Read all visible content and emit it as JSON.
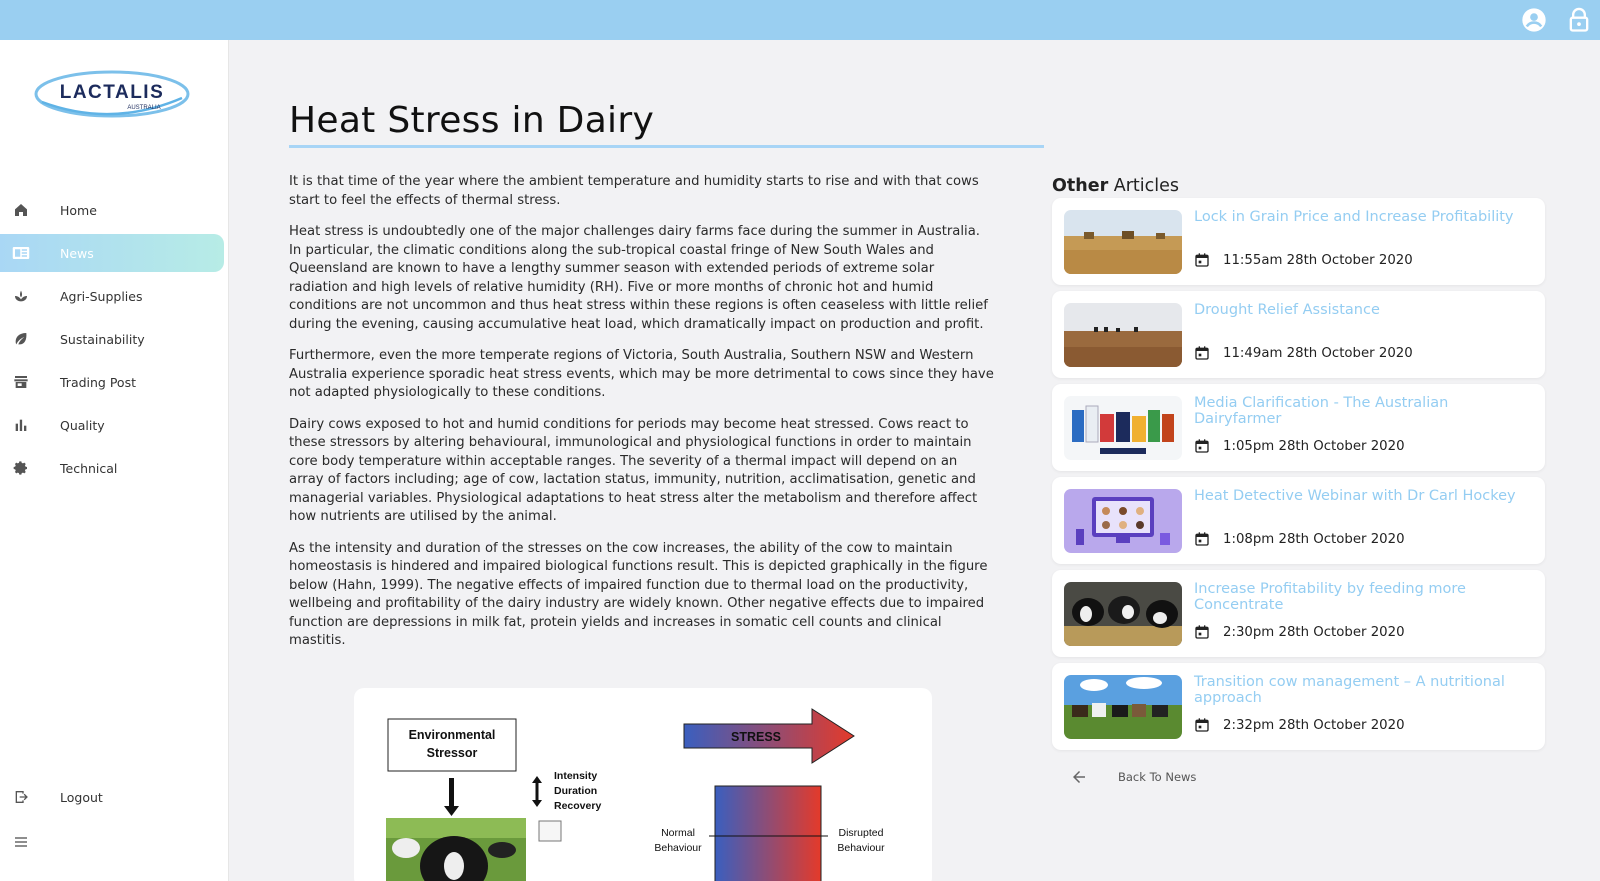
{
  "brand": {
    "name": "LACTALIS",
    "sub": "AUSTRALIA",
    "color": "#1c2b5c",
    "accent": "#9acff1"
  },
  "topbar": {
    "icons": [
      "account-circle-icon",
      "lock-icon"
    ]
  },
  "sidebar": {
    "items": [
      {
        "label": "Home",
        "icon": "home-icon",
        "active": false
      },
      {
        "label": "News",
        "icon": "news-icon",
        "active": true
      },
      {
        "label": "Agri-Supplies",
        "icon": "plant-icon",
        "active": false
      },
      {
        "label": "Sustainability",
        "icon": "leaf-icon",
        "active": false
      },
      {
        "label": "Trading Post",
        "icon": "store-icon",
        "active": false
      },
      {
        "label": "Quality",
        "icon": "bar-chart-icon",
        "active": false
      },
      {
        "label": "Technical",
        "icon": "gear-icon",
        "active": false
      }
    ],
    "logout": "Logout",
    "menu_icon": "hamburger-icon"
  },
  "article": {
    "title": "Heat Stress in Dairy",
    "paragraphs": [
      "It is that time of the year where the ambient temperature and humidity starts to rise and with that cows start to feel the effects of thermal stress.",
      "Heat stress is undoubtedly one of the major challenges dairy farms face during the summer in Australia. In particular, the climatic conditions along the sub-tropical coastal fringe of New South Wales and Queensland are known to have a lengthy summer season with extended periods of extreme solar radiation and high levels of relative humidity (RH). Five or more months of chronic hot and humid conditions are not uncommon and thus heat stress within these regions is often ceaseless with little relief during the evening, causing accumulative heat load, which dramatically impact on production and profit.",
      "Furthermore, even the more temperate regions of Victoria, South Australia, Southern NSW and Western Australia experience sporadic heat stress events, which may be more detrimental to cows since they have not adapted physiologically to these conditions.",
      "Dairy cows exposed to hot and humid conditions for periods may become heat stressed. Cows react to these stressors by altering behavioural, immunological and physiological functions in order to maintain core body temperature within acceptable ranges. The severity of a thermal impact will depend on an array of factors including; age of cow, lactation status, immunity, nutrition, acclimatisation, genetic and managerial variables. Physiological adaptations to heat stress alter the metabolism and therefore affect how nutrients are utilised by the animal.",
      "As the intensity and duration of the stresses on the cow increases, the ability of the cow to maintain homeostasis is hindered and impaired biological functions result. This is depicted graphically in the figure below (Hahn, 1999). The negative effects of impaired function due to thermal load on the productivity, wellbeing and profitability of the dairy industry are widely known. Other negative effects due to impaired function are depressions in milk fat, protein yields and increases in somatic cell counts and clinical mastitis."
    ],
    "figure": {
      "box_line1": "Environmental",
      "box_line2": "Stressor",
      "factor1": "Intensity",
      "factor2": "Duration",
      "factor3": "Recovery",
      "arrow_label": "STRESS",
      "left_label1": "Normal",
      "left_label2": "Behaviour",
      "right_label1": "Disrupted",
      "right_label2": "Behaviour"
    }
  },
  "other_articles": {
    "heading_bold": "Other",
    "heading_rest": " Articles",
    "items": [
      {
        "title": "Lock in Grain Price and Increase Profitability",
        "date": "11:55am 28th October 2020",
        "thumb": "wheat-field-harvest"
      },
      {
        "title": "Drought Relief Assistance",
        "date": "11:49am 28th October 2020",
        "thumb": "dry-paddock-cattle"
      },
      {
        "title": "Media Clarification - The Australian Dairyfarmer",
        "date": "1:05pm 28th October 2020",
        "thumb": "dairy-products"
      },
      {
        "title": "Heat Detective Webinar with Dr Carl Hockey",
        "date": "1:08pm 28th October 2020",
        "thumb": "webinar-illustration"
      },
      {
        "title": "Increase Profitability by feeding more Concentrate",
        "date": "2:30pm 28th October 2020",
        "thumb": "cows-feeding"
      },
      {
        "title": "Transition cow management – A nutritional approach",
        "date": "2:32pm 28th October 2020",
        "thumb": "cows-in-field"
      }
    ],
    "back_label": "Back To News"
  }
}
